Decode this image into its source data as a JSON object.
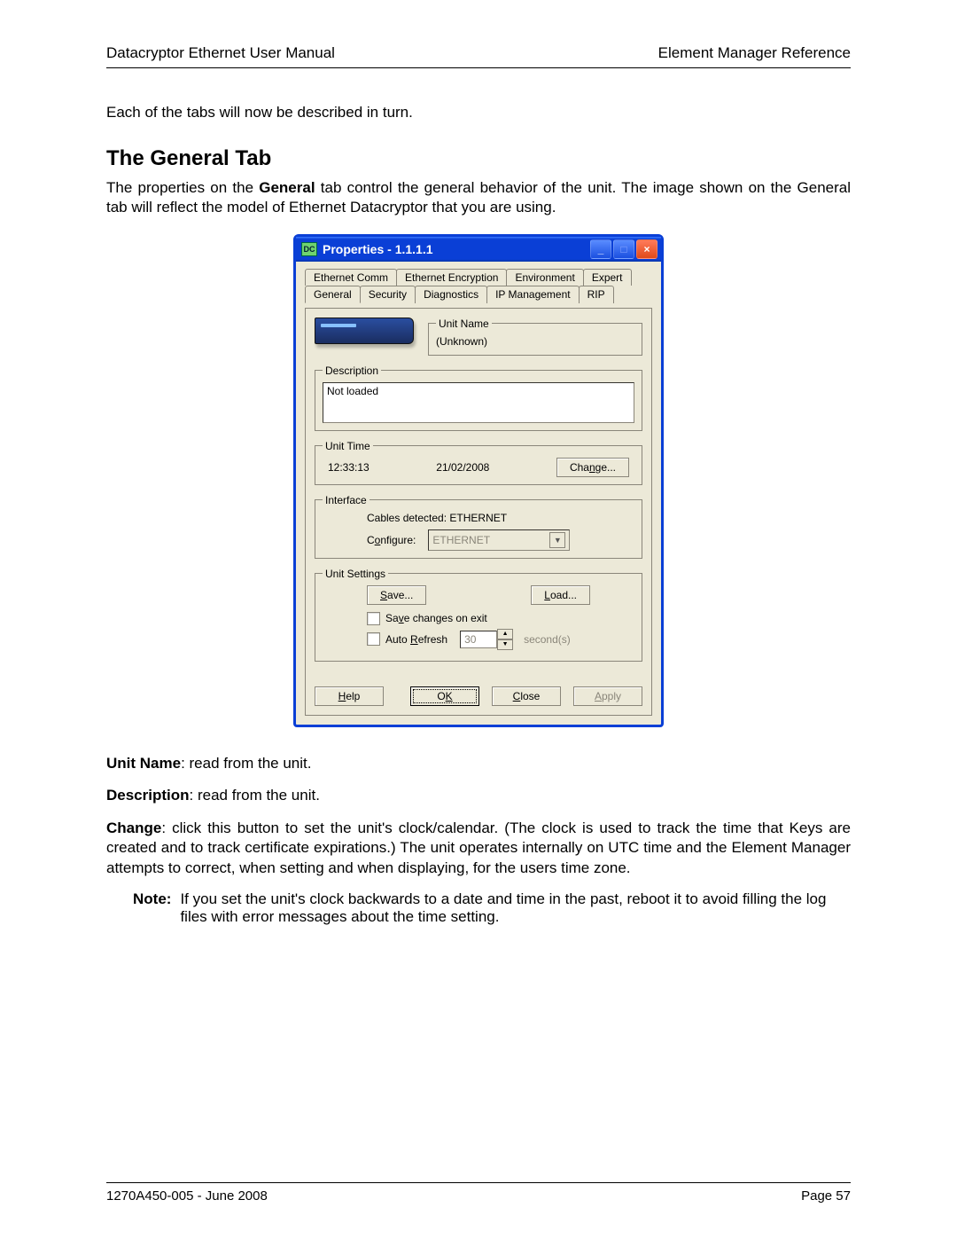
{
  "header": {
    "left": "Datacryptor Ethernet User Manual",
    "right": "Element Manager Reference"
  },
  "intro": "Each of the tabs will now be described in turn.",
  "section_title": "The General Tab",
  "para1_a": "The properties on the ",
  "para1_b": "General",
  "para1_c": " tab control the general behavior of the unit. The image shown on the General tab will reflect the model of Ethernet Datacryptor that you are using.",
  "dialog": {
    "title": "Properties - 1.1.1.1",
    "icon_text": "DC",
    "tabs_back": [
      "Ethernet Comm",
      "Ethernet Encryption",
      "Environment",
      "Expert"
    ],
    "tabs_front": [
      "General",
      "Security",
      "Diagnostics",
      "IP Management",
      "RIP"
    ],
    "unit_name": {
      "legend": "Unit Name",
      "value": "(Unknown)"
    },
    "description": {
      "legend": "Description",
      "value": "Not loaded"
    },
    "unit_time": {
      "legend": "Unit Time",
      "time": "12:33:13",
      "date": "21/02/2008",
      "change_pre": "Cha",
      "change_u": "n",
      "change_post": "ge..."
    },
    "interface": {
      "legend": "Interface",
      "cables": "Cables detected: ETHERNET",
      "configure_pre": "C",
      "configure_u": "o",
      "configure_post": "nfigure:",
      "value": "ETHERNET"
    },
    "unit_settings": {
      "legend": "Unit Settings",
      "save_u": "S",
      "save_post": "ave...",
      "load_u": "L",
      "load_post": "oad...",
      "save_exit_pre": "Sa",
      "save_exit_u": "v",
      "save_exit_post": "e changes on exit",
      "auto_pre": "Auto ",
      "auto_u": "R",
      "auto_post": "efresh",
      "refresh_value": "30",
      "seconds": "second(s)"
    },
    "buttons": {
      "help_u": "H",
      "help_post": "elp",
      "ok_pre": "O",
      "ok_u": "K",
      "close_u": "C",
      "close_post": "lose",
      "apply_u": "A",
      "apply_post": "pply"
    }
  },
  "defs": {
    "unit_name_b": "Unit Name",
    "unit_name_t": ": read from the unit.",
    "description_b": "Description",
    "description_t": ": read from the unit.",
    "change_b": "Change",
    "change_t": ": click this button to set the unit's clock/calendar. (The clock is used to track the time that Keys are created and to track certificate expirations.)  The unit operates internally on UTC time and the Element Manager attempts to correct, when setting and when displaying, for the users time zone."
  },
  "note": {
    "label": "Note:",
    "text": "If you set the unit's clock backwards to a date and time in the past, reboot it to avoid filling the log files with error messages about the time setting."
  },
  "footer": {
    "left": "1270A450-005 -  June 2008",
    "right": "Page 57"
  }
}
